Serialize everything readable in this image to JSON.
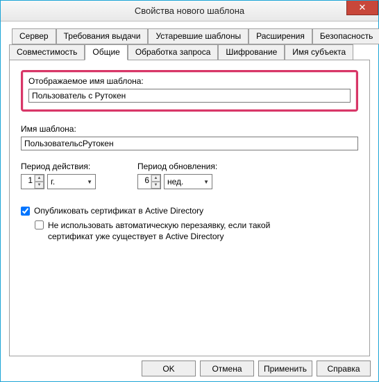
{
  "window": {
    "title": "Свойства нового шаблона",
    "close_glyph": "✕"
  },
  "tabs": {
    "row1": [
      "Сервер",
      "Требования выдачи",
      "Устаревшие шаблоны",
      "Расширения",
      "Безопасность"
    ],
    "row2": [
      "Совместимость",
      "Общие",
      "Обработка запроса",
      "Шифрование",
      "Имя субъекта"
    ],
    "active": "Общие"
  },
  "general": {
    "display_name_label": "Отображаемое имя шаблона:",
    "display_name_value": "Пользователь с Рутокен",
    "template_name_label": "Имя шаблона:",
    "template_name_value": "ПользовательсРутокен",
    "validity_label": "Период действия:",
    "validity_value": "1",
    "validity_unit": "г.",
    "renewal_label": "Период обновления:",
    "renewal_value": "6",
    "renewal_unit": "нед.",
    "publish_label": "Опубликовать сертификат в Active Directory",
    "publish_checked": true,
    "noreenroll_label": "Не использовать автоматическую перезаявку, если такой сертификат уже существует в Active Directory",
    "noreenroll_checked": false
  },
  "buttons": {
    "ok": "OK",
    "cancel": "Отмена",
    "apply": "Применить",
    "help": "Справка"
  }
}
